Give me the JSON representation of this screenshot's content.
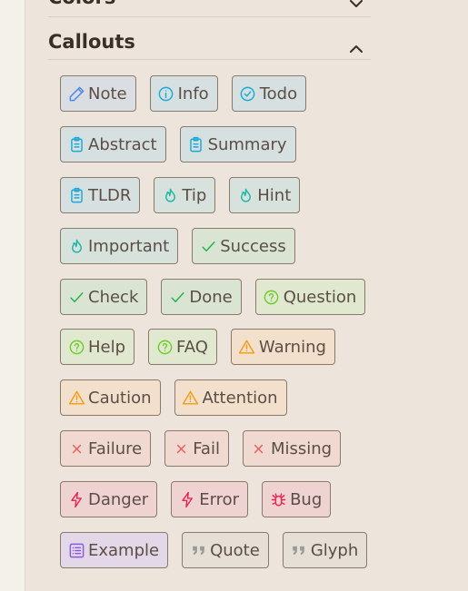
{
  "sections": {
    "colors": {
      "title": "Colors",
      "expanded": false
    },
    "callouts": {
      "title": "Callouts",
      "expanded": true
    }
  },
  "callouts": [
    {
      "label": "Note",
      "icon": "pencil-icon",
      "color": "#4a86e8"
    },
    {
      "label": "Info",
      "icon": "info-icon",
      "color": "#19a9d8"
    },
    {
      "label": "Todo",
      "icon": "check-circle-icon",
      "color": "#19a9d8"
    },
    {
      "label": "Abstract",
      "icon": "clipboard-list-icon",
      "color": "#19a9d8"
    },
    {
      "label": "Summary",
      "icon": "clipboard-list-icon",
      "color": "#19a9d8"
    },
    {
      "label": "TLDR",
      "icon": "clipboard-list-icon",
      "color": "#19a9d8"
    },
    {
      "label": "Tip",
      "icon": "flame-icon",
      "color": "#18b6a6"
    },
    {
      "label": "Hint",
      "icon": "flame-icon",
      "color": "#18b6a6"
    },
    {
      "label": "Important",
      "icon": "flame-icon",
      "color": "#18b6a6"
    },
    {
      "label": "Success",
      "icon": "check-icon",
      "color": "#22b14c"
    },
    {
      "label": "Check",
      "icon": "check-icon",
      "color": "#22b14c"
    },
    {
      "label": "Done",
      "icon": "check-icon",
      "color": "#22b14c"
    },
    {
      "label": "Question",
      "icon": "help-circle-icon",
      "color": "#6ccd26"
    },
    {
      "label": "Help",
      "icon": "help-circle-icon",
      "color": "#6ccd26"
    },
    {
      "label": "FAQ",
      "icon": "help-circle-icon",
      "color": "#6ccd26"
    },
    {
      "label": "Warning",
      "icon": "alert-triangle-icon",
      "color": "#f59a12"
    },
    {
      "label": "Caution",
      "icon": "alert-triangle-icon",
      "color": "#f59a12"
    },
    {
      "label": "Attention",
      "icon": "alert-triangle-icon",
      "color": "#f59a12"
    },
    {
      "label": "Failure",
      "icon": "x-icon",
      "color": "#ee5b5b"
    },
    {
      "label": "Fail",
      "icon": "x-icon",
      "color": "#ee5b5b"
    },
    {
      "label": "Missing",
      "icon": "x-icon",
      "color": "#ee5b5b"
    },
    {
      "label": "Danger",
      "icon": "zap-icon",
      "color": "#e8264f"
    },
    {
      "label": "Error",
      "icon": "zap-icon",
      "color": "#e8264f"
    },
    {
      "label": "Bug",
      "icon": "bug-icon",
      "color": "#e8264f"
    },
    {
      "label": "Example",
      "icon": "list-icon",
      "color": "#8e57e6"
    },
    {
      "label": "Quote",
      "icon": "quote-icon",
      "color": "#9a9a9a"
    },
    {
      "label": "Glyph",
      "icon": "quote-icon",
      "color": "#9a9a9a"
    }
  ]
}
